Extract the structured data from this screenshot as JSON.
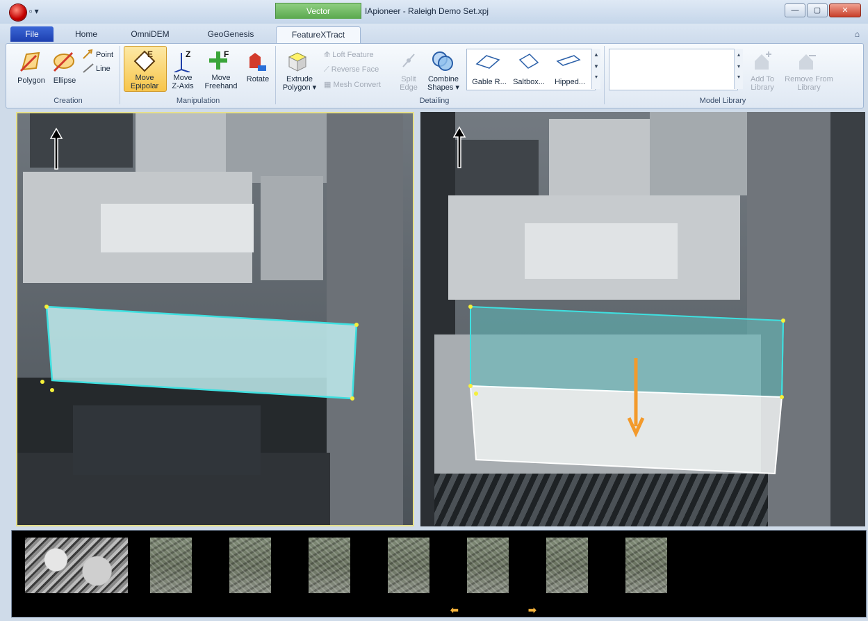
{
  "window": {
    "title": "IApioneer - Raleigh Demo Set.xpj",
    "context_tab_group": "Vector",
    "qat": "▫ ▾",
    "controls": {
      "minimize": "—",
      "maximize": "▢",
      "close": "✕"
    }
  },
  "tabs": [
    "File",
    "Home",
    "OmniDEM",
    "GeoGenesis",
    "FeatureXTract"
  ],
  "active_tab": "FeatureXTract",
  "ribbon": {
    "groups": {
      "creation": "Creation",
      "manipulation": "Manipulation",
      "detailing": "Detailing",
      "model_library": "Model Library"
    },
    "creation": {
      "polygon": "Polygon",
      "ellipse": "Ellipse",
      "point": "Point",
      "line": "Line"
    },
    "manipulation": {
      "move_epipolar": [
        "Move",
        "Epipolar"
      ],
      "move_z_axis": [
        "Move",
        "Z-Axis"
      ],
      "move_freehand": [
        "Move",
        "Freehand"
      ],
      "rotate": "Rotate"
    },
    "detailing": {
      "extrude": [
        "Extrude",
        "Polygon ▾"
      ],
      "loft_feature": "Loft Feature",
      "reverse_face": "Reverse Face",
      "mesh_convert": "Mesh Convert",
      "split_edge": [
        "Split",
        "Edge"
      ],
      "combine_shapes": [
        "Combine",
        "Shapes ▾"
      ]
    },
    "gallery": [
      "Gable R...",
      "Saltbox...",
      "Hipped..."
    ],
    "library": {
      "add": [
        "Add To",
        "Library"
      ],
      "remove": [
        "Remove From",
        "Library"
      ]
    }
  },
  "colors": {
    "selected_button": "#f7c54a",
    "file_tab": "#2447c0",
    "polygon_outline": "#3ee0e0",
    "arrow": "#f39a2b"
  },
  "icons": [
    "north-arrow-icon",
    "up-arrow-icon",
    "prev-arrow-icon",
    "next-arrow-icon"
  ],
  "filmstrip": {
    "thumbnail_count": 8,
    "prev": "⬅",
    "next": "➡"
  }
}
